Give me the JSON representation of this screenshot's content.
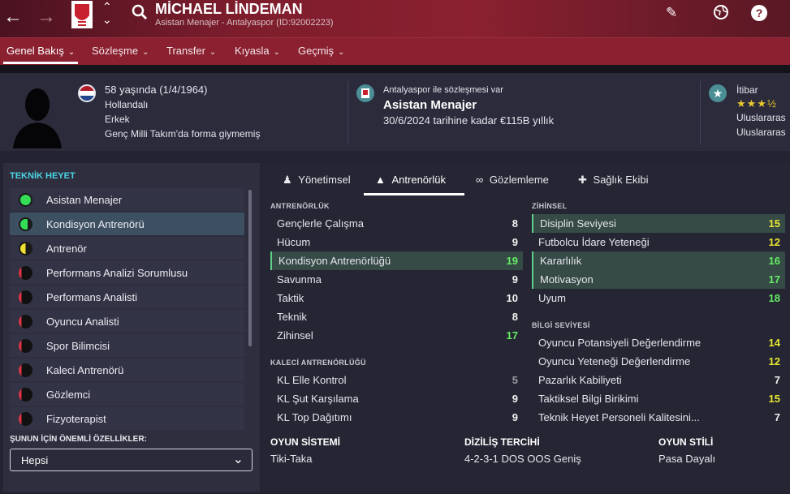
{
  "header": {
    "name": "MİCHAEL LİNDEMAN",
    "subtitle": "Asistan Menajer - Antalyaspor (ID:92002223)"
  },
  "tabs": [
    {
      "label": "Genel Bakış"
    },
    {
      "label": "Sözleşme"
    },
    {
      "label": "Transfer"
    },
    {
      "label": "Kıyasla"
    },
    {
      "label": "Geçmiş"
    }
  ],
  "info": {
    "age": "58 yaşında (1/4/1964)",
    "nation": "Hollandalı",
    "gender": "Erkek",
    "youth": "Genç Milli Takım'da forma giymemiş",
    "contract_label": "Antalyaspor ile sözleşmesi var",
    "role": "Asistan Menajer",
    "contract_detail": "30/6/2024 tarihine kadar €115B yıllık",
    "rep_label": "İtibar",
    "rep_line1": "Uluslararas",
    "rep_line2": "Uluslararas",
    "rep_stars": "★★★½"
  },
  "left": {
    "title": "TEKNİK HEYET",
    "staff": [
      "Asistan Menajer",
      "Kondisyon Antrenörü",
      "Antrenör",
      "Performans Analizi Sorumlusu",
      "Performans Analisti",
      "Oyuncu Analisti",
      "Spor Bilimcisi",
      "Kaleci Antrenörü",
      "Gözlemci",
      "Fizyoterapist"
    ],
    "filter_label": "ŞUNUN İÇİN ÖNEMLİ ÖZELLİKLER:",
    "filter_value": "Hepsi"
  },
  "subtabs": [
    "Yönetimsel",
    "Antrenörlük",
    "Gözlemleme",
    "Sağlık Ekibi"
  ],
  "sections": {
    "coaching": "ANTRENÖRLÜK",
    "gk": "KALECİ ANTRENÖRLÜĞÜ",
    "mental": "ZİHİNSEL",
    "knowledge": "BİLGİ SEVİYESİ"
  },
  "coaching": [
    {
      "n": "Gençlerle Çalışma",
      "v": "8"
    },
    {
      "n": "Hücum",
      "v": "9"
    },
    {
      "n": "Kondisyon Antrenörlüğü",
      "v": "19"
    },
    {
      "n": "Savunma",
      "v": "9"
    },
    {
      "n": "Taktik",
      "v": "10"
    },
    {
      "n": "Teknik",
      "v": "8"
    },
    {
      "n": "Zihinsel",
      "v": "17"
    }
  ],
  "gk": [
    {
      "n": "KL Elle Kontrol",
      "v": "5"
    },
    {
      "n": "KL Şut Karşılama",
      "v": "9"
    },
    {
      "n": "KL Top Dağıtımı",
      "v": "9"
    }
  ],
  "mental": [
    {
      "n": "Disiplin Seviyesi",
      "v": "15"
    },
    {
      "n": "Futbolcu İdare Yeteneği",
      "v": "12"
    },
    {
      "n": "Kararlılık",
      "v": "16"
    },
    {
      "n": "Motivasyon",
      "v": "17"
    },
    {
      "n": "Uyum",
      "v": "18"
    }
  ],
  "knowledge": [
    {
      "n": "Oyuncu Potansiyeli Değerlendirme",
      "v": "14"
    },
    {
      "n": "Oyuncu Yeteneği Değerlendirme",
      "v": "12"
    },
    {
      "n": "Pazarlık Kabiliyeti",
      "v": "7"
    },
    {
      "n": "Taktiksel Bilgi Birikimi",
      "v": "15"
    },
    {
      "n": "Teknik Heyet Personeli Kalitesini...",
      "v": "7"
    }
  ],
  "bottom": {
    "system_t": "OYUN SİSTEMİ",
    "system_v": "Tiki-Taka",
    "form_t": "DİZİLİŞ TERCİHİ",
    "form_v": "4-2-3-1 DOS OOS Geniş",
    "style_t": "OYUN STİLİ",
    "style_v": "Pasa Dayalı"
  }
}
